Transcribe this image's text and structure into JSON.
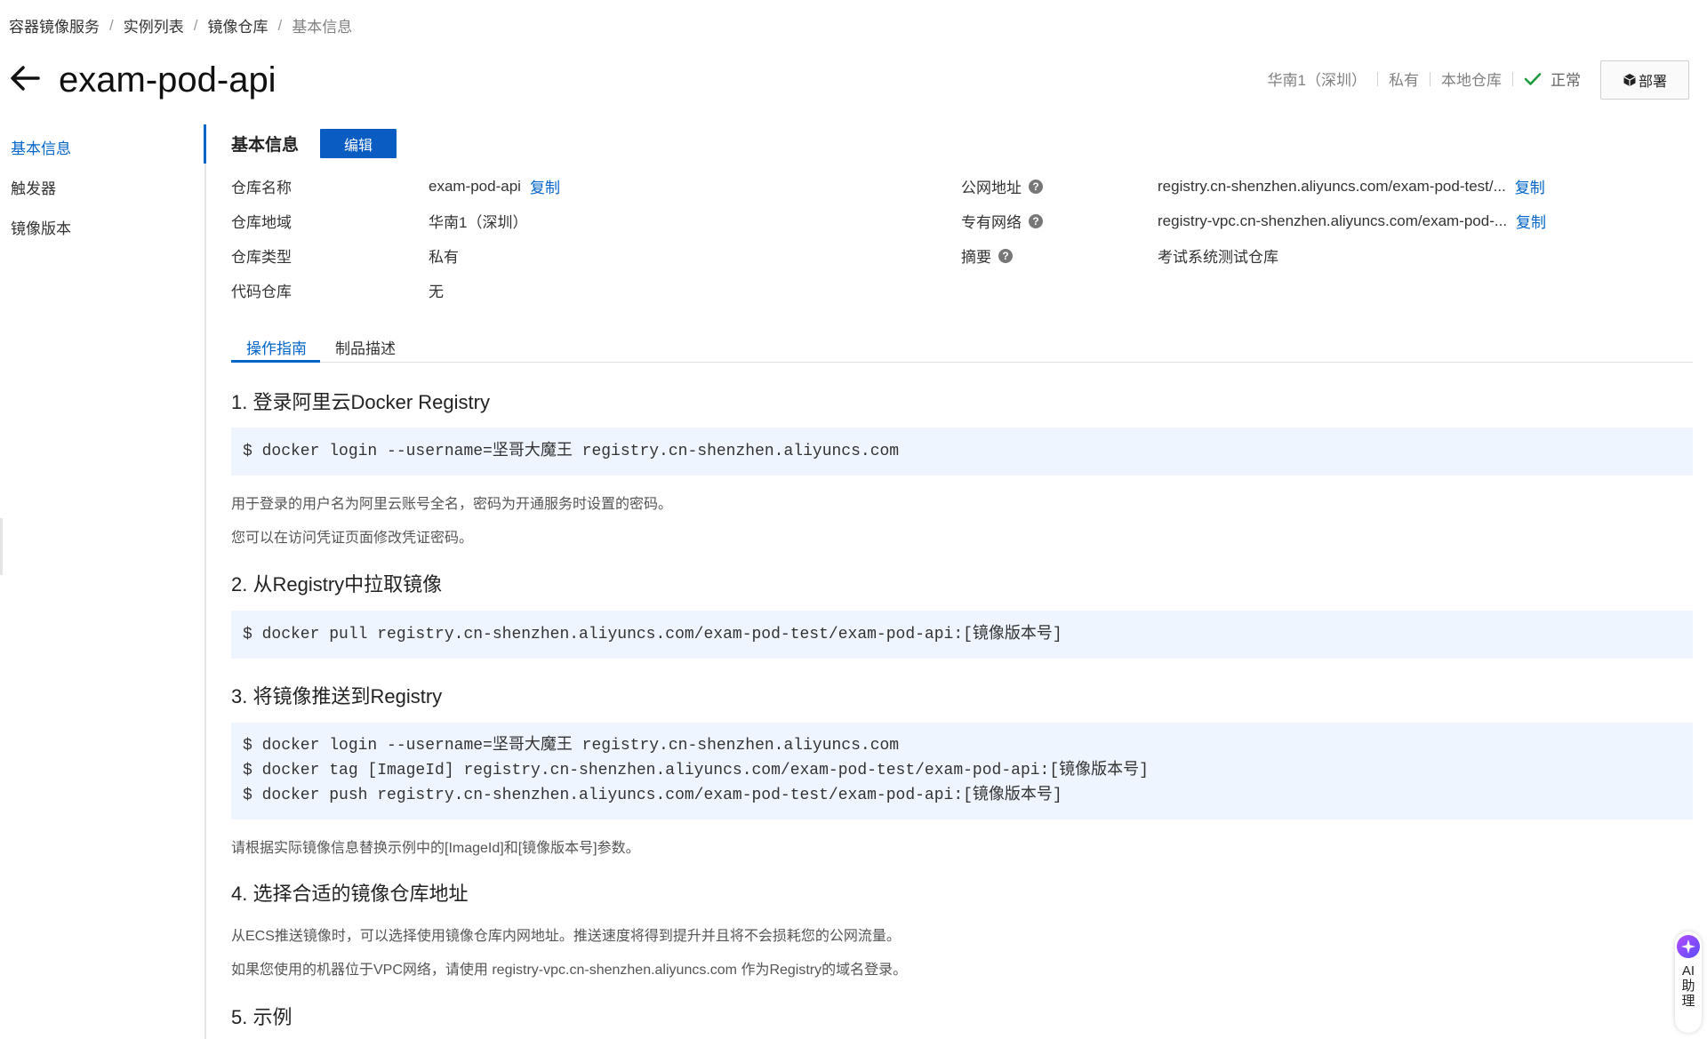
{
  "breadcrumb": {
    "items": [
      "容器镜像服务",
      "实例列表",
      "镜像仓库",
      "基本信息"
    ],
    "separator": "/"
  },
  "header": {
    "title": "exam-pod-api",
    "region": "华南1（深圳）",
    "visibility": "私有",
    "source": "本地仓库",
    "status": "正常",
    "status_color": "#1e9b3c",
    "deploy_label": "部署"
  },
  "sidebar": {
    "items": [
      {
        "label": "基本信息",
        "active": true
      },
      {
        "label": "触发器",
        "active": false
      },
      {
        "label": "镜像版本",
        "active": false
      }
    ],
    "accent": "#0064c8"
  },
  "basic_info": {
    "title": "基本信息",
    "edit_label": "编辑",
    "left": [
      {
        "label": "仓库名称",
        "value": "exam-pod-api",
        "copy": "复制"
      },
      {
        "label": "仓库地域",
        "value": "华南1（深圳）"
      },
      {
        "label": "仓库类型",
        "value": "私有"
      },
      {
        "label": "代码仓库",
        "value": "无"
      }
    ],
    "right": [
      {
        "label": "公网地址",
        "value": "registry.cn-shenzhen.aliyuncs.com/exam-pod-test/...",
        "copy": "复制",
        "help": "?"
      },
      {
        "label": "专有网络",
        "value": "registry-vpc.cn-shenzhen.aliyuncs.com/exam-pod-...",
        "copy": "复制",
        "help": "?"
      },
      {
        "label": "摘要",
        "value": "考试系统测试仓库",
        "help": "?"
      }
    ]
  },
  "tabs": [
    {
      "label": "操作指南",
      "active": true
    },
    {
      "label": "制品描述",
      "active": false
    }
  ],
  "guide": {
    "step1": {
      "title": "1. 登录阿里云Docker Registry",
      "code": [
        "$ docker login --username=坚哥大魔王 registry.cn-shenzhen.aliyuncs.com"
      ],
      "notes": [
        "用于登录的用户名为阿里云账号全名，密码为开通服务时设置的密码。",
        "您可以在访问凭证页面修改凭证密码。"
      ]
    },
    "step2": {
      "title": "2. 从Registry中拉取镜像",
      "code": [
        "$ docker pull registry.cn-shenzhen.aliyuncs.com/exam-pod-test/exam-pod-api:[镜像版本号]"
      ]
    },
    "step3": {
      "title": "3. 将镜像推送到Registry",
      "code": [
        "$ docker login --username=坚哥大魔王 registry.cn-shenzhen.aliyuncs.com",
        "$ docker tag [ImageId] registry.cn-shenzhen.aliyuncs.com/exam-pod-test/exam-pod-api:[镜像版本号]",
        "$ docker push registry.cn-shenzhen.aliyuncs.com/exam-pod-test/exam-pod-api:[镜像版本号]"
      ],
      "notes": [
        "请根据实际镜像信息替换示例中的[ImageId]和[镜像版本号]参数。"
      ]
    },
    "step4": {
      "title": "4. 选择合适的镜像仓库地址",
      "notes": [
        "从ECS推送镜像时，可以选择使用镜像仓库内网地址。推送速度将得到提升并且将不会损耗您的公网流量。",
        "如果您使用的机器位于VPC网络，请使用 registry-vpc.cn-shenzhen.aliyuncs.com 作为Registry的域名登录。"
      ]
    },
    "step5": {
      "title": "5. 示例"
    }
  },
  "ai_helper": {
    "label": "AI助理",
    "icon": "sparkle-icon"
  },
  "icons": [
    "arrow-left-icon",
    "check-icon",
    "cube-icon",
    "help-icon",
    "sparkle-icon"
  ]
}
